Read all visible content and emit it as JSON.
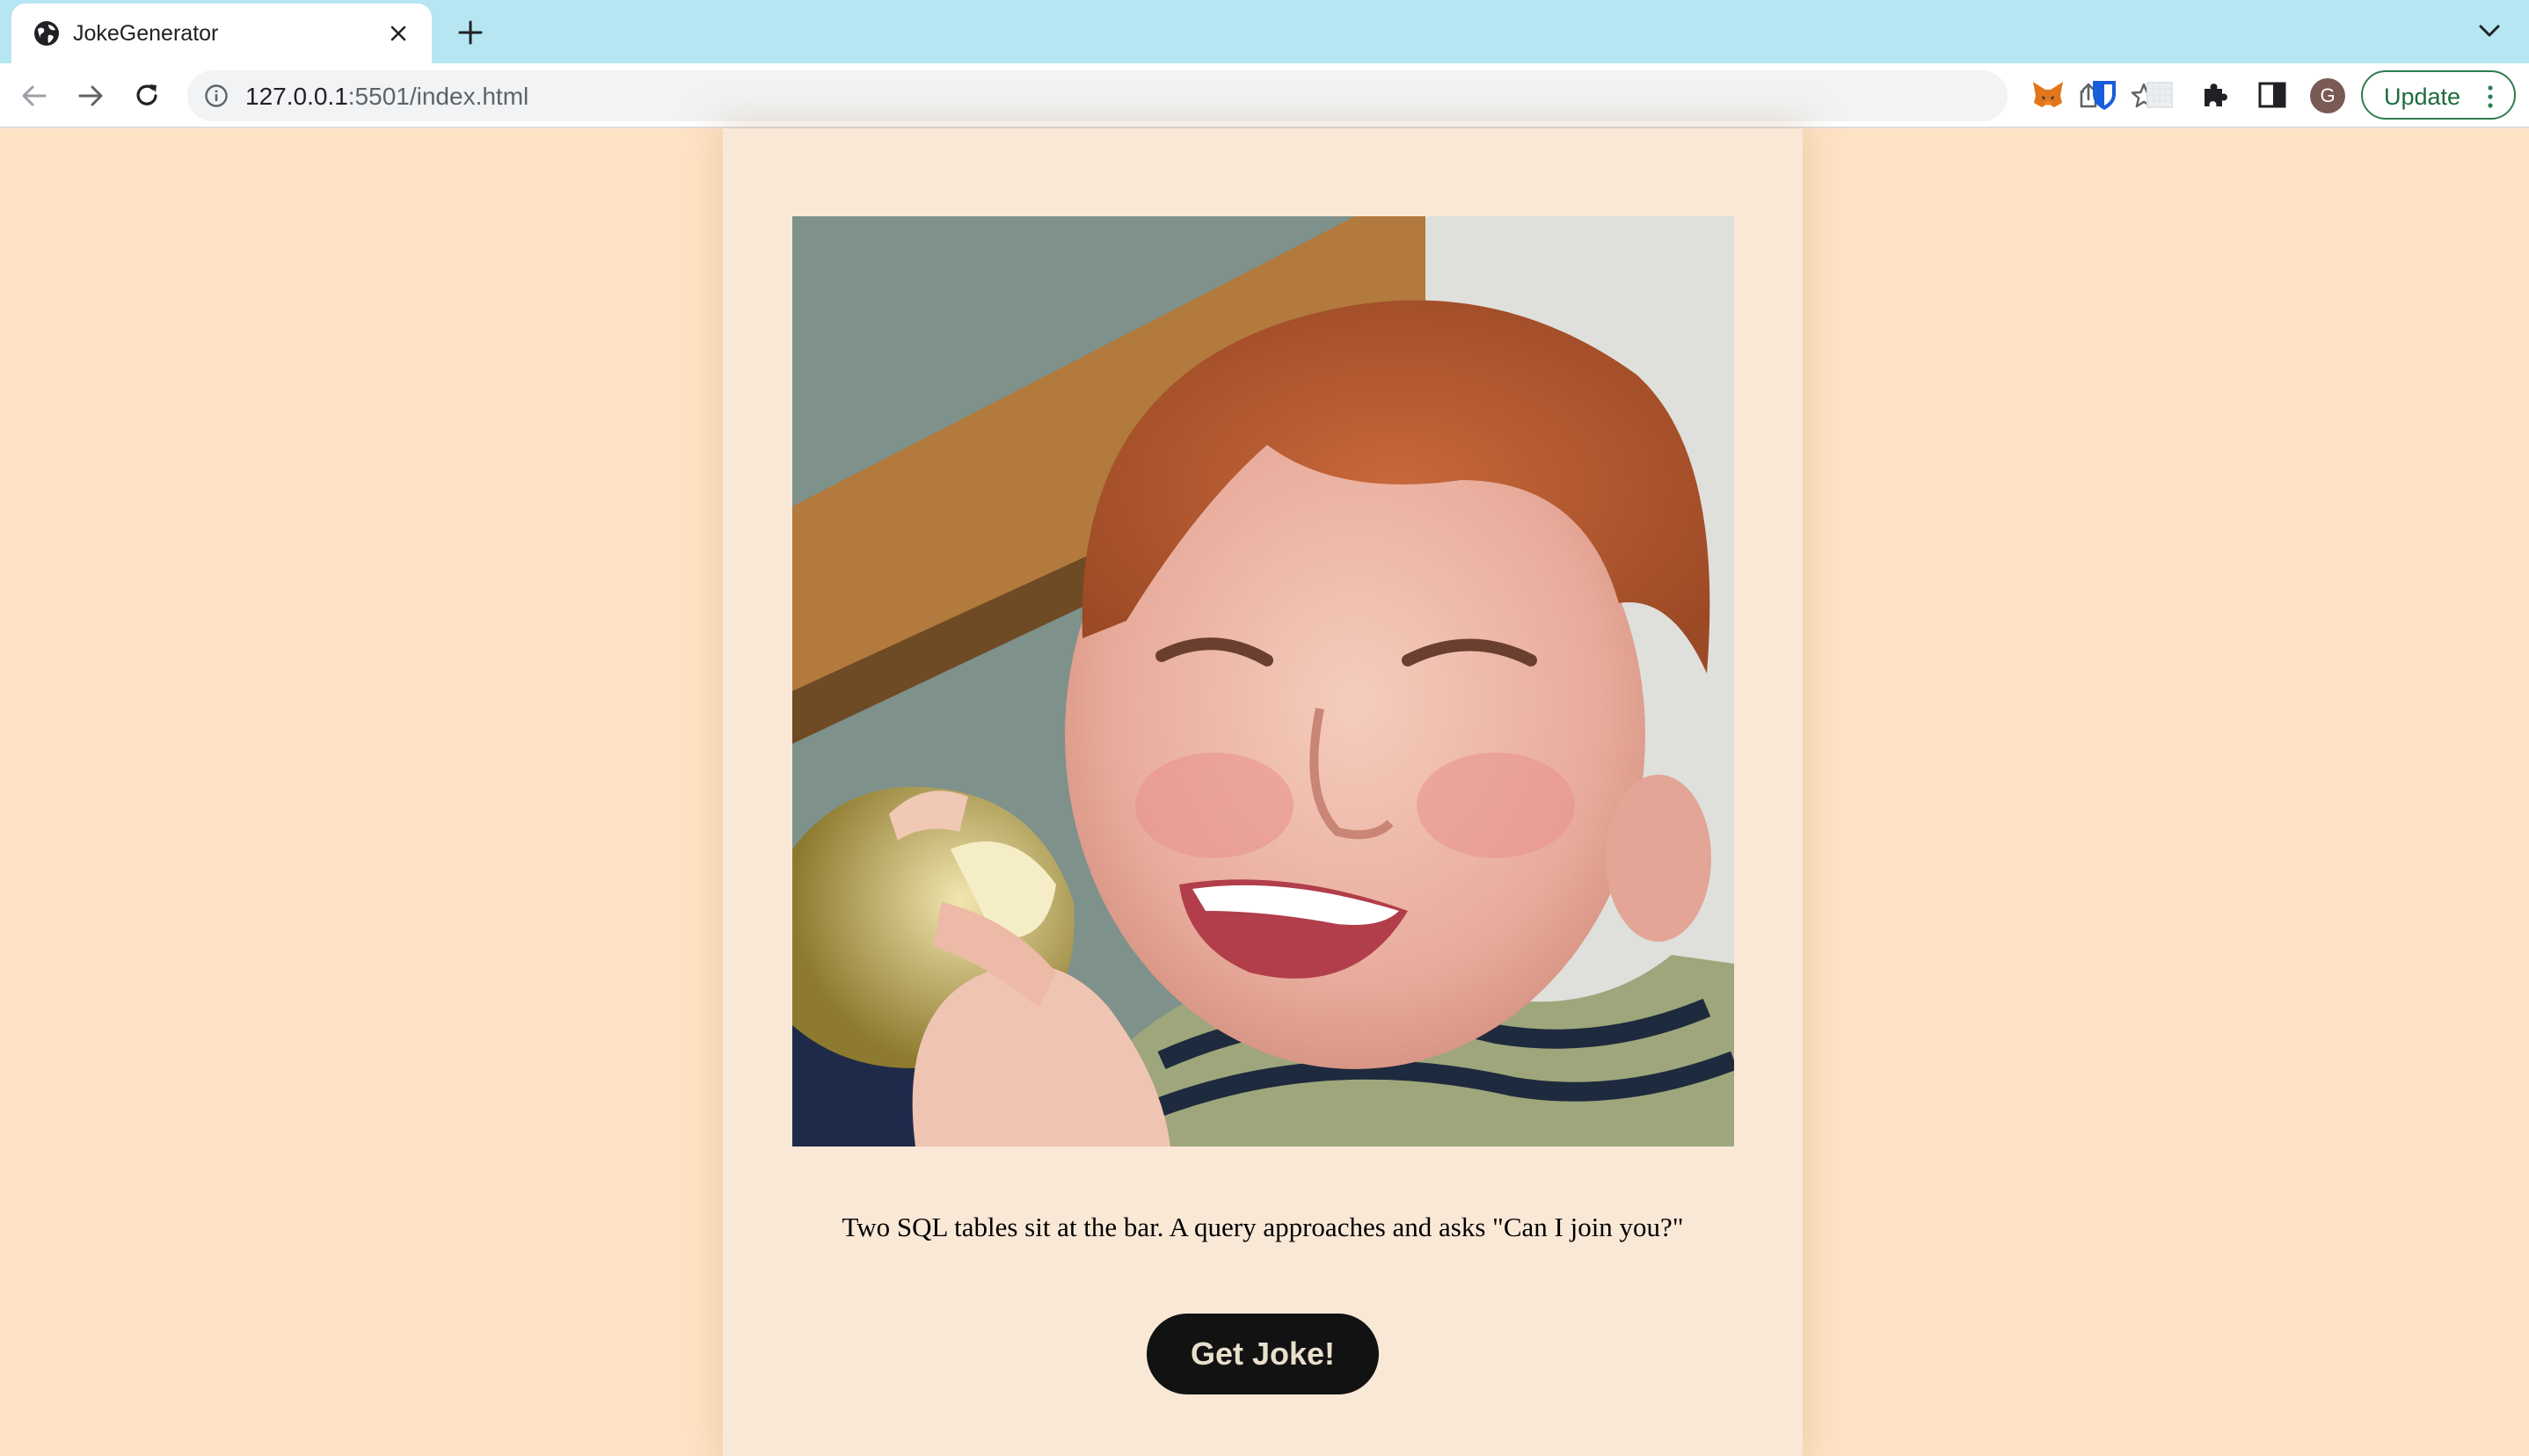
{
  "browser": {
    "tab": {
      "title": "JokeGenerator",
      "favicon": "globe-icon"
    },
    "address_bar": {
      "host": "127.0.0.1",
      "path": ":5501/index.html"
    },
    "toolbar": {
      "avatar_initial": "G",
      "update_label": "Update",
      "extensions": [
        "metamask-icon",
        "bitwarden-icon",
        "blank-extension-icon",
        "puzzle-icon",
        "side-panel-icon"
      ]
    },
    "colors": {
      "tabbar": "#b5e6f2",
      "update_border": "#2e7d4f"
    }
  },
  "page": {
    "background": "#ffe3c5",
    "card_background": "#fae8d7",
    "image_subject": "laughing-child-eating-apple",
    "joke": "Two SQL tables sit at the bar. A query approaches and asks \"Can I join you?\"",
    "button_label": "Get Joke!"
  }
}
